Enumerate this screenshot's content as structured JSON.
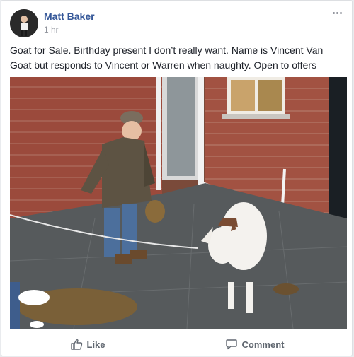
{
  "post": {
    "author": "Matt Baker",
    "timestamp": "1 hr",
    "text": "Goat for Sale. Birthday present I don’t really want. Name is Vincent Van Goat but responds to Vincent or Warren when naughty. Open to offers"
  },
  "actions": {
    "like_label": "Like",
    "comment_label": "Comment"
  },
  "icons": {
    "more": "more-options-icon",
    "like": "thumbs-up-icon",
    "comment": "comment-bubble-icon"
  },
  "colors": {
    "author_link": "#365899",
    "meta_text": "#90949c",
    "action_text": "#606770"
  }
}
